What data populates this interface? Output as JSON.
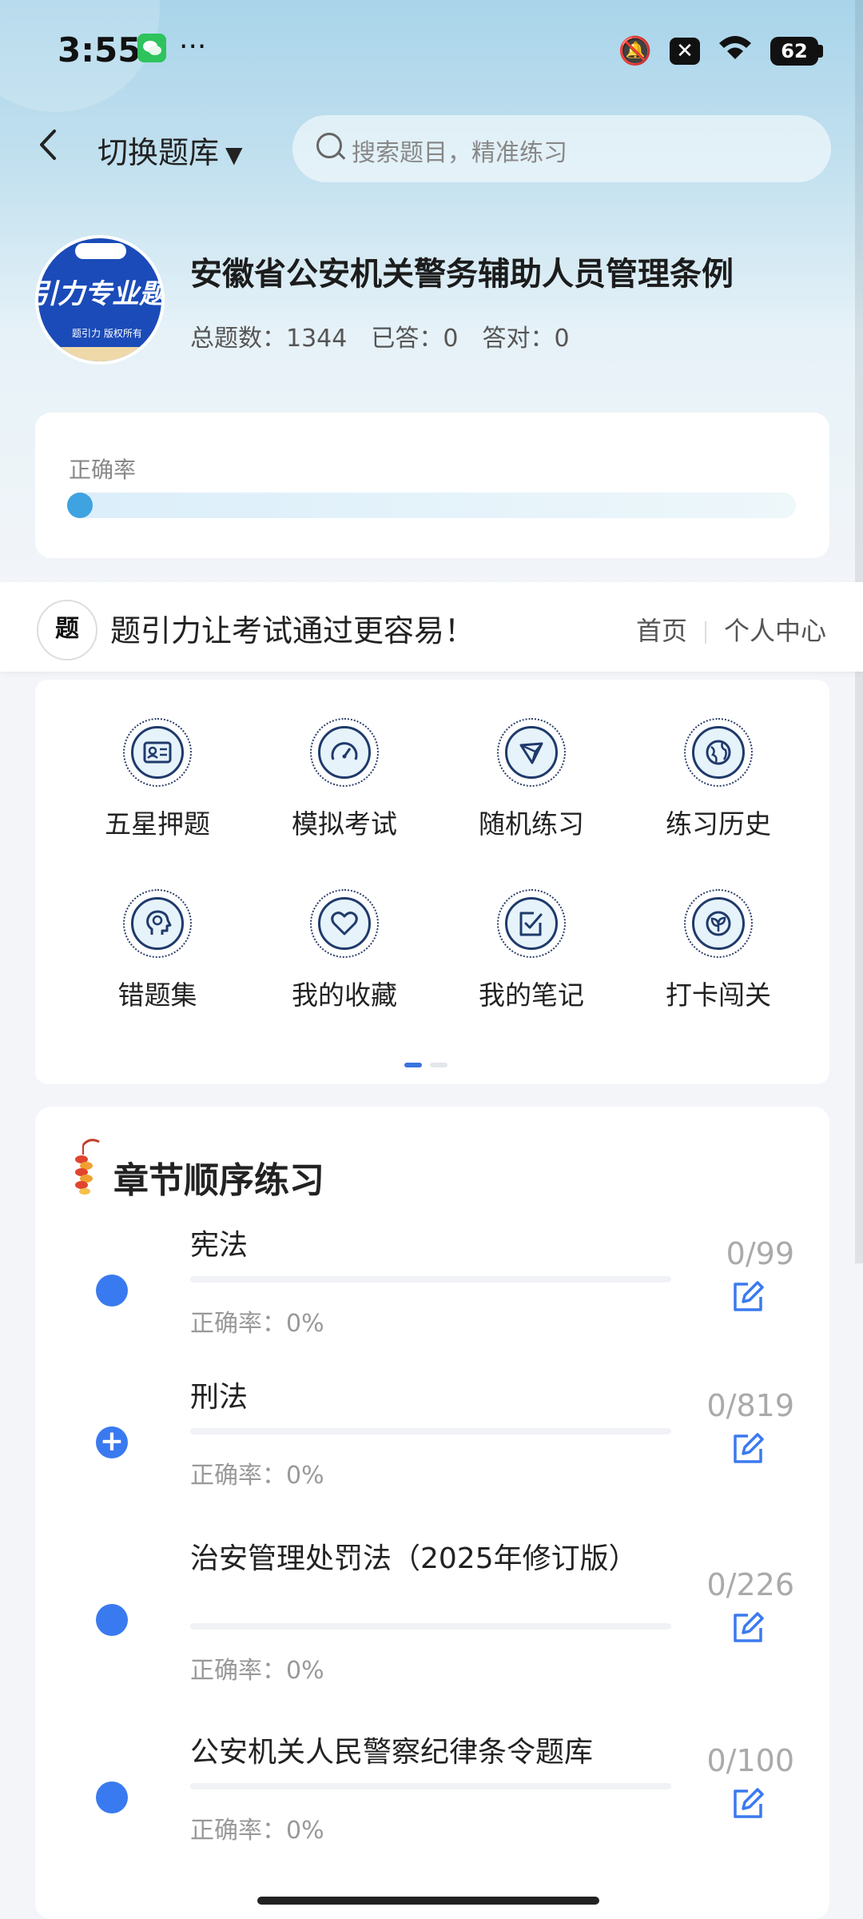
{
  "status_bar": {
    "time": "3:55",
    "more": "···",
    "battery": "62",
    "icons": [
      "wechat-icon",
      "mute-bell-icon",
      "close-box-icon",
      "wifi-icon",
      "battery-icon"
    ]
  },
  "nav": {
    "switch_label": "切换题库",
    "search_placeholder": "搜索题目，精准练习"
  },
  "header": {
    "logo_big_text": "引力专业题",
    "logo_small_text": "题引力 版权所有",
    "title": "安徽省公安机关警务辅助人员管理条例",
    "total": "总题数：1344",
    "answered": "已答：0",
    "correct": "答对：0"
  },
  "accuracy": {
    "label": "正确率",
    "value_percent": 0
  },
  "brand_bar": {
    "logo_text": "题引力",
    "slogan": "题引力让考试通过更容易！",
    "home": "首页",
    "profile": "个人中心"
  },
  "grid": {
    "items": [
      {
        "label": "五星押题",
        "icon": "id-card-icon"
      },
      {
        "label": "模拟考试",
        "icon": "speedometer-icon"
      },
      {
        "label": "随机练习",
        "icon": "random-network-icon"
      },
      {
        "label": "练习历史",
        "icon": "globe-icon"
      },
      {
        "label": "错题集",
        "icon": "head-brain-icon"
      },
      {
        "label": "我的收藏",
        "icon": "heart-icon"
      },
      {
        "label": "我的笔记",
        "icon": "note-check-icon"
      },
      {
        "label": "打卡闯关",
        "icon": "leaf-badge-icon"
      }
    ],
    "page_indicator": {
      "current": 1,
      "total": 2
    }
  },
  "chapters": {
    "title": "章节顺序练习",
    "items": [
      {
        "name": "宪法",
        "rate": "正确率：0%",
        "count": "0/99"
      },
      {
        "name": "刑法",
        "rate": "正确率：0%",
        "count": "0/819"
      },
      {
        "name": "治安管理处罚法（2025年修订版）",
        "rate": "正确率：0%",
        "count": "0/226"
      },
      {
        "name": "公安机关人民警察纪律条令题库",
        "rate": "正确率：0%",
        "count": "0/100"
      }
    ]
  },
  "colors": {
    "accent": "#3a7af0",
    "progress": "#3ea3e0",
    "icon_stroke": "#1f3a6b"
  }
}
